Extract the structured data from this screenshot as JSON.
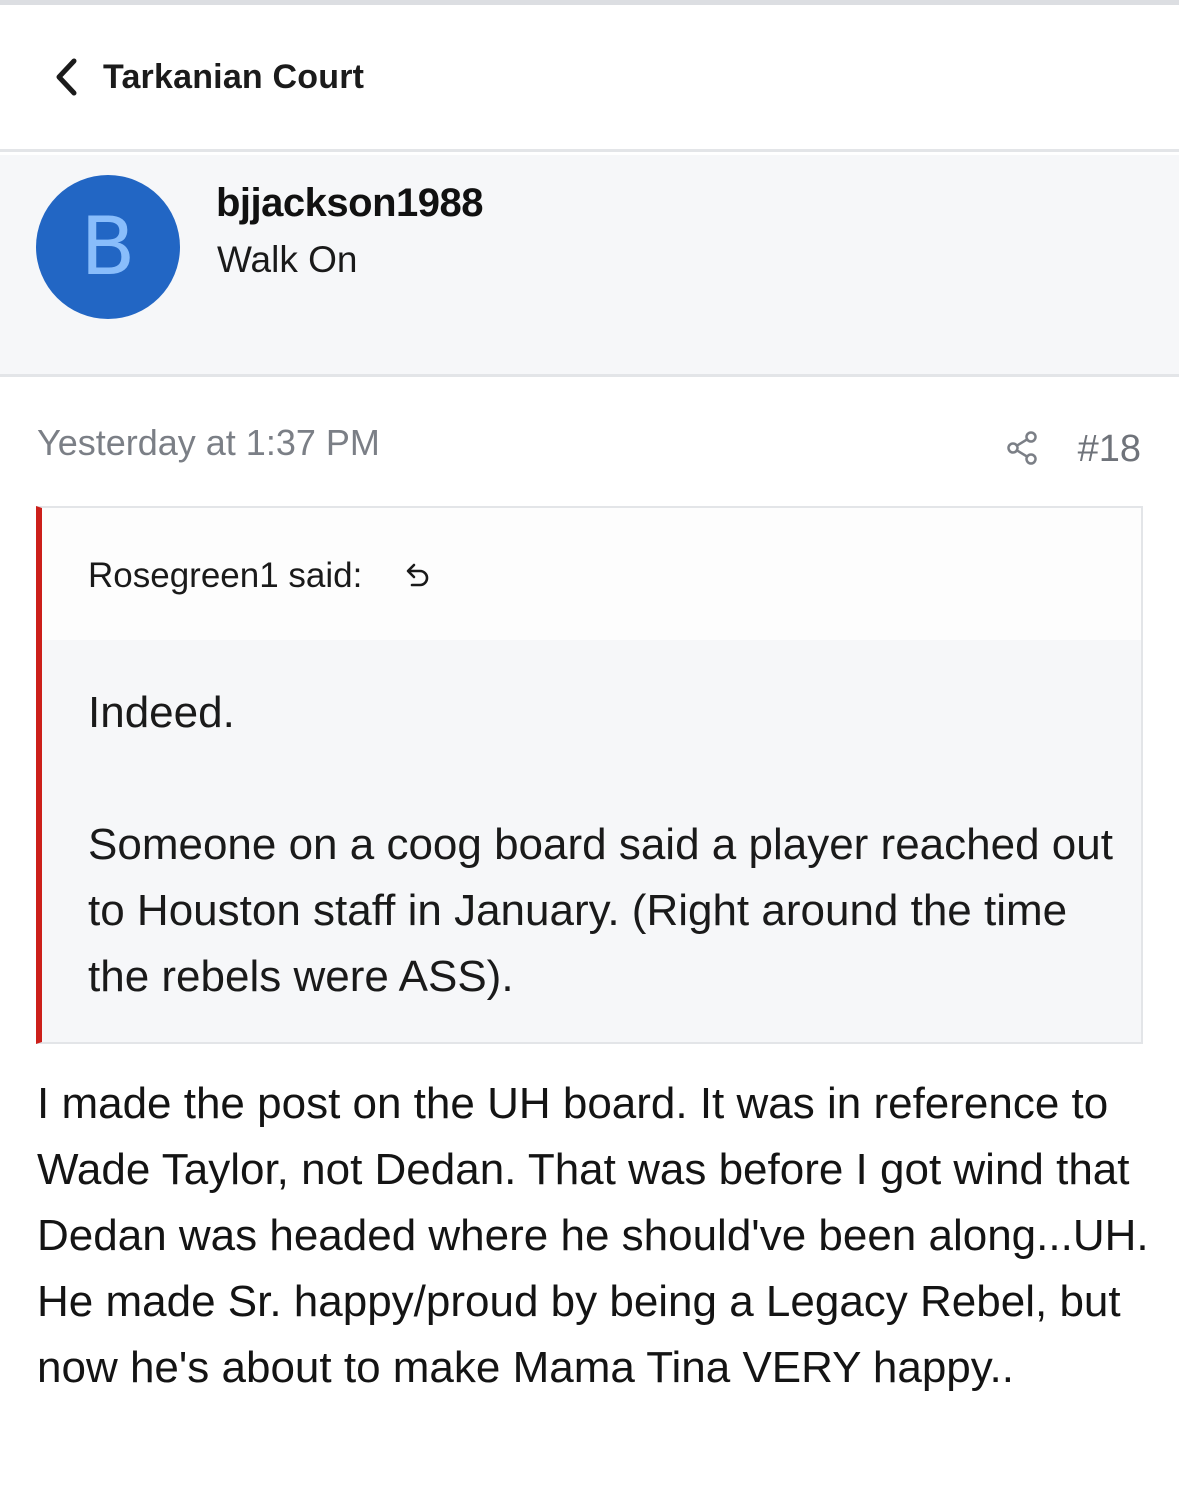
{
  "nav": {
    "forum_title": "Tarkanian Court"
  },
  "author": {
    "avatar_letter": "B",
    "username": "bjjackson1988",
    "user_title": "Walk On"
  },
  "post": {
    "date": "Yesterday at 1:37 PM",
    "number": "#18",
    "quote": {
      "attribution": "Rosegreen1 said:",
      "paragraph_1": "Indeed.",
      "paragraph_2": "Someone on a coog board said a player reached out to Houston staff in January. (Right around the time the rebels were ASS)."
    },
    "message": "I made the post on the UH board. It was in reference to Wade Taylor, not Dedan. That was before I got wind that Dedan was headed where he should've been along...UH. He made Sr. happy/proud by being a Legacy Rebel, but now he's about to make Mama Tina VERY happy.."
  },
  "icons": {
    "back": "chevron-left-icon",
    "share": "share-icon",
    "quote_jump": "jump-to-quote-icon"
  },
  "colors": {
    "avatar_bg": "#2266c4",
    "avatar_letter": "#89bdfb",
    "quote_accent": "#cc1f1a",
    "panel_bg": "#f6f7f9",
    "muted_text": "#7b7f86"
  }
}
